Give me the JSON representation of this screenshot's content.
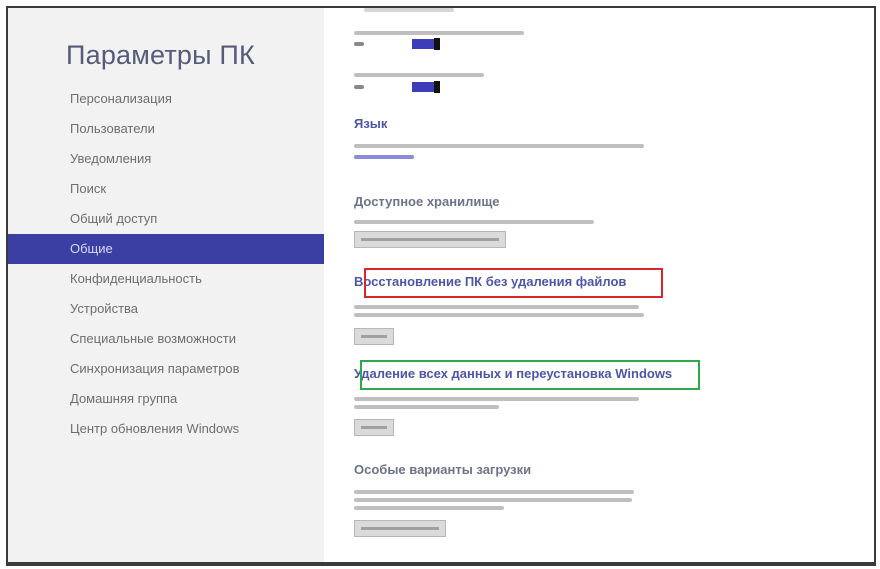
{
  "app_title": "Параметры ПК",
  "nav": {
    "items": [
      {
        "label": "Персонализация"
      },
      {
        "label": "Пользователи"
      },
      {
        "label": "Уведомления"
      },
      {
        "label": "Поиск"
      },
      {
        "label": "Общий доступ"
      },
      {
        "label": "Общие"
      },
      {
        "label": "Конфиденциальность"
      },
      {
        "label": "Устройства"
      },
      {
        "label": "Специальные возможности"
      },
      {
        "label": "Синхронизация параметров"
      },
      {
        "label": "Домашняя группа"
      },
      {
        "label": "Центр обновления Windows"
      }
    ],
    "active_index": 5
  },
  "sections": {
    "language": {
      "title": "Язык"
    },
    "storage": {
      "title": "Доступное хранилище"
    },
    "refresh": {
      "title": "Восстановление ПК без удаления файлов"
    },
    "reset": {
      "title": "Удаление всех данных и переустановка Windows"
    },
    "advanced_startup": {
      "title": "Особые варианты загрузки"
    }
  },
  "colors": {
    "nav_active_bg": "#3b3ea3",
    "section_title": "#4d56a8",
    "highlight_red": "#d8262c",
    "highlight_green": "#2ea84a",
    "toggle_on": "#3d3dbb"
  }
}
